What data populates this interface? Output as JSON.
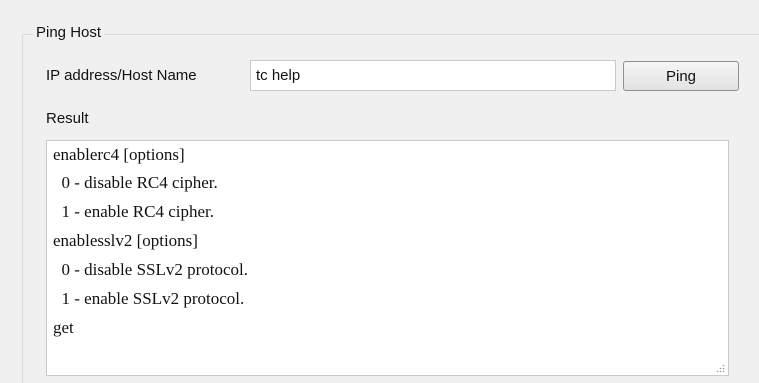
{
  "group": {
    "title": "Ping Host"
  },
  "ip_field": {
    "label": "IP address/Host Name",
    "value": "tc help"
  },
  "ping_button": {
    "label": "Ping"
  },
  "result": {
    "label": "Result",
    "lines": [
      "enablerc4 [options]",
      "  0 - disable RC4 cipher.",
      "  1 - enable RC4 cipher.",
      "enablesslv2 [options]",
      "  0 - disable SSLv2 protocol.",
      "  1 - enable SSLv2 protocol.",
      "get"
    ]
  },
  "icons": {
    "resize_grip": "resize-grip-icon"
  },
  "colors": {
    "background": "#f0f0f0",
    "border": "#c9c9c9",
    "text": "#111111"
  }
}
